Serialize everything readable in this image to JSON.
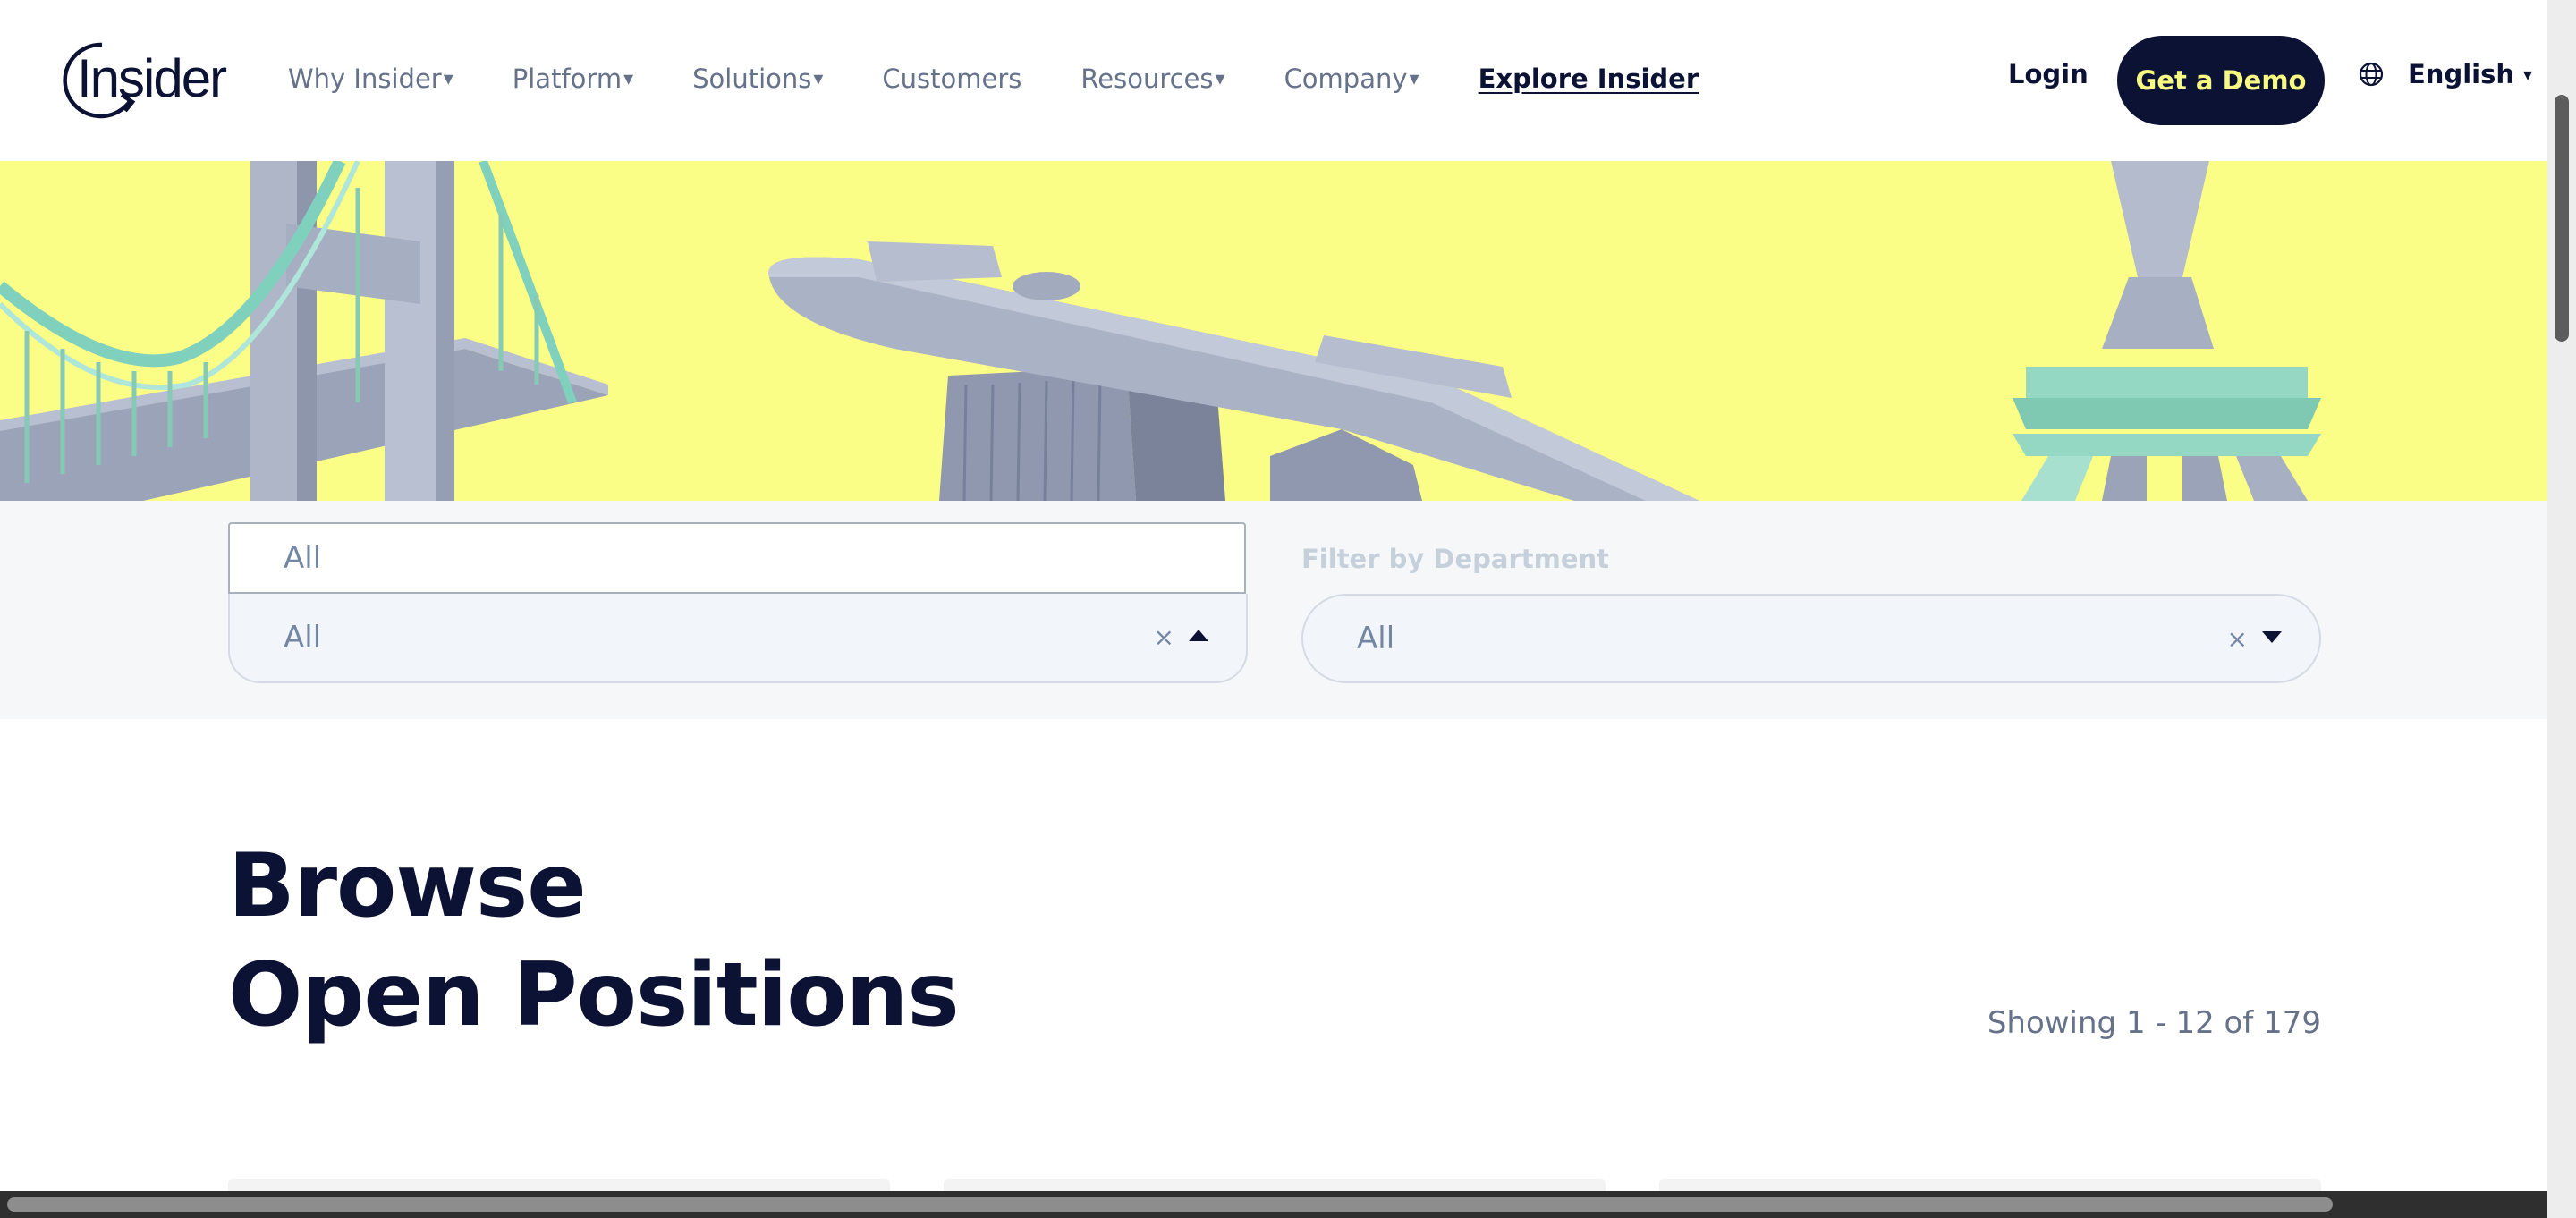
{
  "header": {
    "brand": "Insider",
    "nav": [
      {
        "label": "Why Insider",
        "has_caret": true
      },
      {
        "label": "Platform",
        "has_caret": true
      },
      {
        "label": "Solutions",
        "has_caret": true
      },
      {
        "label": "Customers",
        "has_caret": false
      },
      {
        "label": "Resources",
        "has_caret": true
      },
      {
        "label": "Company",
        "has_caret": true
      }
    ],
    "nav_caret": "▾",
    "explore_label": "Explore Insider",
    "login_label": "Login",
    "demo_label": "Get a Demo",
    "language_label": "English",
    "language_caret": "▾"
  },
  "filters": {
    "location_search_value": "All",
    "location_selected": "All",
    "department_label": "Filter by Department",
    "department_selected": "All",
    "clear_glyph": "×"
  },
  "main": {
    "title_line1": "Browse",
    "title_line2": "Open Positions",
    "results_count": "Showing 1 - 12 of 179"
  },
  "colors": {
    "navy": "#0b1233",
    "hero_yellow": "#fbfe86",
    "demo_text": "#f8f982",
    "muted_text": "#66728a"
  },
  "icons": [
    "insider-logo",
    "globe-icon",
    "chevron-down-icon",
    "clear-icon",
    "caret-up-icon",
    "caret-down-icon"
  ]
}
